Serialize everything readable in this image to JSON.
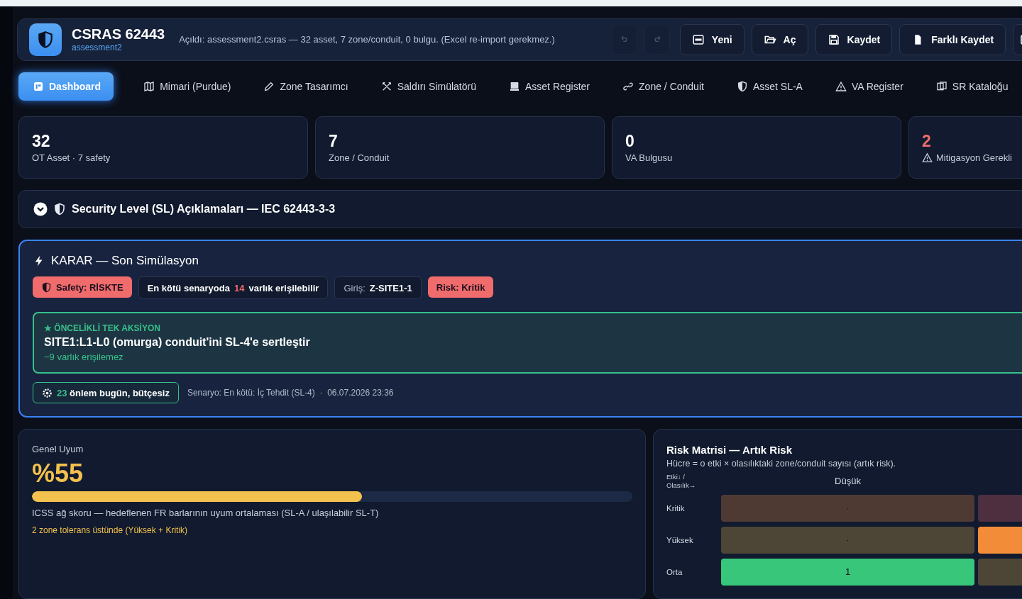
{
  "header": {
    "app_name": "CSRAS 62443",
    "file_name": "assessment2",
    "message": "Açıldı: assessment2.csras — 32 asset, 7 zone/conduit, 0 bulgu. (Excel re-import gerekmez.)",
    "history_buttons": [
      {
        "kind": "undo",
        "disabled": true
      },
      {
        "kind": "redo",
        "disabled": true
      }
    ],
    "buttons": [
      {
        "kind": "new",
        "label": "Yeni"
      },
      {
        "kind": "open",
        "label": "Aç"
      },
      {
        "kind": "save",
        "label": "Kaydet"
      },
      {
        "kind": "save_as",
        "label": "Farklı Kaydet"
      },
      {
        "kind": "export"
      }
    ]
  },
  "tabs": [
    {
      "kind": "dashboard",
      "label": "Dashboard",
      "selected": true
    },
    {
      "kind": "map",
      "label": "Mimari (Purdue)",
      "selected": false
    },
    {
      "kind": "pencil",
      "label": "Zone Tasarımcı",
      "selected": false
    },
    {
      "kind": "swords",
      "label": "Saldırı Simülatörü",
      "selected": false
    },
    {
      "kind": "register",
      "label": "Asset Register",
      "selected": false
    },
    {
      "kind": "link",
      "label": "Zone / Conduit",
      "selected": false
    },
    {
      "kind": "shield",
      "label": "Asset SL-A",
      "selected": false
    },
    {
      "kind": "warning",
      "label": "VA Register",
      "selected": false
    },
    {
      "kind": "catalog",
      "label": "SR Kataloğu",
      "selected": false
    }
  ],
  "stats": [
    {
      "value": "32",
      "label": "OT Asset · 7 safety",
      "alert": false
    },
    {
      "value": "7",
      "label": "Zone / Conduit",
      "alert": false
    },
    {
      "value": "0",
      "label": "VA Bulgusu",
      "alert": false
    },
    {
      "value": "2",
      "label": "Mitigasyon Gerekli",
      "alert": true
    }
  ],
  "sl_section": {
    "title": "Security Level (SL) Açıklamaları — IEC 62443-3-3",
    "expanded": false
  },
  "decision": {
    "title": "KARAR — Son Simülasyon",
    "chips": [
      {
        "kind": "safety",
        "text": "Safety: RİSKTE"
      },
      {
        "kind": "neutral",
        "text": "En kötü senaryoda **14** varlık erişilebilir"
      },
      {
        "kind": "field",
        "label": "Giriş:",
        "text": "Z-SITE1-1"
      },
      {
        "kind": "danger",
        "text": "Risk: Kritik"
      }
    ],
    "action": {
      "kicker": "★ ÖNCELİKLİ TEK AKSİYON",
      "title": "SITE1:L1-L0 (omurga) conduit'ini SL-4'e sertleştir",
      "effect": "−9 varlık erişilemez"
    },
    "measures": "**23** önlem bugün, bütçesiz",
    "scenario": "Senaryo: En kötü: İç Tehdit (SL-4)  ·  06.07.2026 23:36"
  },
  "compliance": {
    "label": "Genel Uyum",
    "value": "%55",
    "level": 0.55,
    "description": "ICSS ağ skoru — hedeflenen FR barlarının uyum ortalaması (SL-A / ulaşılabilir SL-T)",
    "warning": "2 zone tolerans üstünde (Yüksek + Kritik)"
  },
  "risk_matrix": {
    "title": "Risk Matrisi — Artık Risk",
    "subtitle": "Hücre = o etki × olasılıktaki zone/conduit sayısı (artık risk).",
    "axis_label": "Etki↓ / Olasılık→",
    "columns": [
      "Düşük"
    ],
    "rows": [
      {
        "label": "Kritik",
        "cells": [
          {
            "value": "·",
            "color": "#4f3a33"
          },
          {
            "color": "#4e2f40"
          }
        ]
      },
      {
        "label": "Yüksek",
        "cells": [
          {
            "value": "·",
            "color": "#4d4636"
          },
          {
            "color": "#f28c38"
          }
        ]
      },
      {
        "label": "Orta",
        "cells": [
          {
            "value": "1",
            "color": "#38c77a"
          },
          {
            "color": "#4d4636"
          }
        ]
      }
    ]
  }
}
